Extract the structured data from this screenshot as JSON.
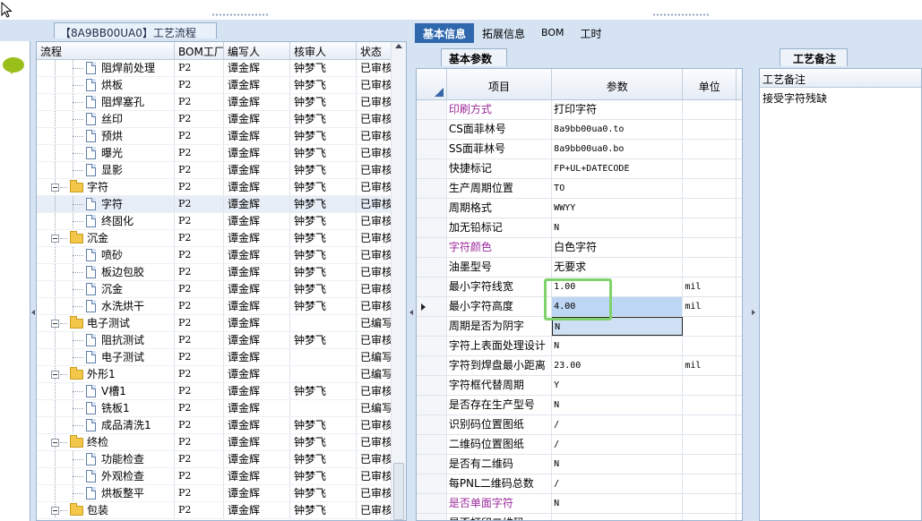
{
  "process_panel": {
    "title": "【8A9BB00UA0】工艺流程",
    "columns": [
      "流程",
      "BOM工厂",
      "编写人",
      "核审人",
      "状态"
    ],
    "rows": [
      {
        "level": 2,
        "type": "doc",
        "name": "阻焊前处理",
        "bom": "P2",
        "author": "谭金辉",
        "reviewer": "钟梦飞",
        "status": "已审核"
      },
      {
        "level": 2,
        "type": "doc",
        "name": "烘板",
        "bom": "P2",
        "author": "谭金辉",
        "reviewer": "钟梦飞",
        "status": "已审核"
      },
      {
        "level": 2,
        "type": "doc",
        "name": "阻焊塞孔",
        "bom": "P2",
        "author": "谭金辉",
        "reviewer": "钟梦飞",
        "status": "已审核"
      },
      {
        "level": 2,
        "type": "doc",
        "name": "丝印",
        "bom": "P2",
        "author": "谭金辉",
        "reviewer": "钟梦飞",
        "status": "已审核"
      },
      {
        "level": 2,
        "type": "doc",
        "name": "预烘",
        "bom": "P2",
        "author": "谭金辉",
        "reviewer": "钟梦飞",
        "status": "已审核"
      },
      {
        "level": 2,
        "type": "doc",
        "name": "曝光",
        "bom": "P2",
        "author": "谭金辉",
        "reviewer": "钟梦飞",
        "status": "已审核"
      },
      {
        "level": 2,
        "type": "doc",
        "name": "显影",
        "bom": "P2",
        "author": "谭金辉",
        "reviewer": "钟梦飞",
        "status": "已审核"
      },
      {
        "level": 1,
        "type": "folder",
        "name": "字符",
        "bom": "P2",
        "author": "谭金辉",
        "reviewer": "钟梦飞",
        "status": "已审核"
      },
      {
        "level": 2,
        "type": "doc",
        "name": "字符",
        "bom": "P2",
        "author": "谭金辉",
        "reviewer": "钟梦飞",
        "status": "已审核",
        "selected": true
      },
      {
        "level": 2,
        "type": "doc",
        "name": "终固化",
        "bom": "P2",
        "author": "谭金辉",
        "reviewer": "钟梦飞",
        "status": "已审核"
      },
      {
        "level": 1,
        "type": "folder",
        "name": "沉金",
        "bom": "P2",
        "author": "谭金辉",
        "reviewer": "钟梦飞",
        "status": "已审核"
      },
      {
        "level": 2,
        "type": "doc",
        "name": "喷砂",
        "bom": "P2",
        "author": "谭金辉",
        "reviewer": "钟梦飞",
        "status": "已审核"
      },
      {
        "level": 2,
        "type": "doc",
        "name": "板边包胶",
        "bom": "P2",
        "author": "谭金辉",
        "reviewer": "钟梦飞",
        "status": "已审核"
      },
      {
        "level": 2,
        "type": "doc",
        "name": "沉金",
        "bom": "P2",
        "author": "谭金辉",
        "reviewer": "钟梦飞",
        "status": "已审核"
      },
      {
        "level": 2,
        "type": "doc",
        "name": "水洗烘干",
        "bom": "P2",
        "author": "谭金辉",
        "reviewer": "钟梦飞",
        "status": "已审核"
      },
      {
        "level": 1,
        "type": "folder",
        "name": "电子测试",
        "bom": "P2",
        "author": "谭金辉",
        "reviewer": "",
        "status": "已编写"
      },
      {
        "level": 2,
        "type": "doc",
        "name": "阻抗测试",
        "bom": "P2",
        "author": "谭金辉",
        "reviewer": "钟梦飞",
        "status": "已审核"
      },
      {
        "level": 2,
        "type": "doc",
        "name": "电子测试",
        "bom": "P2",
        "author": "谭金辉",
        "reviewer": "",
        "status": "已编写"
      },
      {
        "level": 1,
        "type": "folder",
        "name": "外形1",
        "bom": "P2",
        "author": "谭金辉",
        "reviewer": "",
        "status": "已编写"
      },
      {
        "level": 2,
        "type": "doc",
        "name": "V槽1",
        "bom": "P2",
        "author": "谭金辉",
        "reviewer": "钟梦飞",
        "status": "已审核"
      },
      {
        "level": 2,
        "type": "doc",
        "name": "铣板1",
        "bom": "P2",
        "author": "谭金辉",
        "reviewer": "",
        "status": "已编写"
      },
      {
        "level": 2,
        "type": "doc",
        "name": "成品清洗1",
        "bom": "P2",
        "author": "谭金辉",
        "reviewer": "钟梦飞",
        "status": "已审核"
      },
      {
        "level": 1,
        "type": "folder",
        "name": "终检",
        "bom": "P2",
        "author": "谭金辉",
        "reviewer": "钟梦飞",
        "status": "已审核"
      },
      {
        "level": 2,
        "type": "doc",
        "name": "功能检查",
        "bom": "P2",
        "author": "谭金辉",
        "reviewer": "钟梦飞",
        "status": "已审核"
      },
      {
        "level": 2,
        "type": "doc",
        "name": "外观检查",
        "bom": "P2",
        "author": "谭金辉",
        "reviewer": "钟梦飞",
        "status": "已审核"
      },
      {
        "level": 2,
        "type": "doc",
        "name": "烘板整平",
        "bom": "P2",
        "author": "谭金辉",
        "reviewer": "钟梦飞",
        "status": "已审核"
      },
      {
        "level": 1,
        "type": "folder",
        "name": "包装",
        "bom": "P2",
        "author": "谭金辉",
        "reviewer": "钟梦飞",
        "status": "已审核"
      }
    ]
  },
  "tabs": [
    {
      "label": "基本信息",
      "active": true
    },
    {
      "label": "拓展信息",
      "active": false
    },
    {
      "label": "BOM",
      "active": false
    },
    {
      "label": "工时",
      "active": false
    }
  ],
  "params_panel": {
    "tab_label": "基本参数",
    "columns": [
      "项目",
      "参数",
      "单位"
    ],
    "rows": [
      {
        "item": "印刷方式",
        "value": "打印字符",
        "unit": "",
        "purple": true
      },
      {
        "item": "CS面菲林号",
        "value": "8a9bb00ua0.to",
        "unit": "",
        "small": true
      },
      {
        "item": "SS面菲林号",
        "value": "8a9bb00ua0.bo",
        "unit": "",
        "small": true
      },
      {
        "item": "快捷标记",
        "value": "FP+UL+DATECODE",
        "unit": "",
        "small": true
      },
      {
        "item": "生产周期位置",
        "value": "TO",
        "unit": "",
        "small": true
      },
      {
        "item": "周期格式",
        "value": "WWYY",
        "unit": "",
        "small": true
      },
      {
        "item": "加无铅标记",
        "value": "N",
        "unit": "",
        "small": true
      },
      {
        "item": "字符颜色",
        "value": "白色字符",
        "unit": "",
        "purple": true
      },
      {
        "item": "油墨型号",
        "value": "无要求",
        "unit": ""
      },
      {
        "item": "最小字符线宽",
        "value": "1.00",
        "unit": "mil",
        "small": true
      },
      {
        "item": "最小字符高度",
        "value": "4.00",
        "unit": "mil",
        "small": true,
        "highlight": true,
        "current": true
      },
      {
        "item": "周期是否为阴字",
        "value": "N",
        "unit": "",
        "small": true,
        "editing": true
      },
      {
        "item": "字符上表面处理设计",
        "value": "N",
        "unit": "",
        "small": true
      },
      {
        "item": "字符到焊盘最小距离",
        "value": "23.00",
        "unit": "mil",
        "small": true
      },
      {
        "item": "字符框代替周期",
        "value": "Y",
        "unit": "",
        "small": true
      },
      {
        "item": "是否存在生产型号",
        "value": "N",
        "unit": "",
        "small": true
      },
      {
        "item": "识别码位置图纸",
        "value": "/",
        "unit": "",
        "small": true
      },
      {
        "item": "二维码位置图纸",
        "value": "/",
        "unit": "",
        "small": true
      },
      {
        "item": "是否有二维码",
        "value": "N",
        "unit": "",
        "small": true
      },
      {
        "item": "每PNL二维码总数",
        "value": "/",
        "unit": "",
        "small": true
      },
      {
        "item": "是否单面字符",
        "value": "N",
        "unit": "",
        "small": true,
        "purple": true
      },
      {
        "item": "是否打印二维码",
        "value": "",
        "unit": ""
      }
    ]
  },
  "notes_panel": {
    "tab_label": "工艺备注",
    "header": "工艺备注",
    "content": "接受字符残缺"
  },
  "colors": {
    "accent": "#2f68ad",
    "frame": "#d5e3f3",
    "purple_label": "#9b2a9b",
    "highlight_box": "#7ed36a"
  }
}
